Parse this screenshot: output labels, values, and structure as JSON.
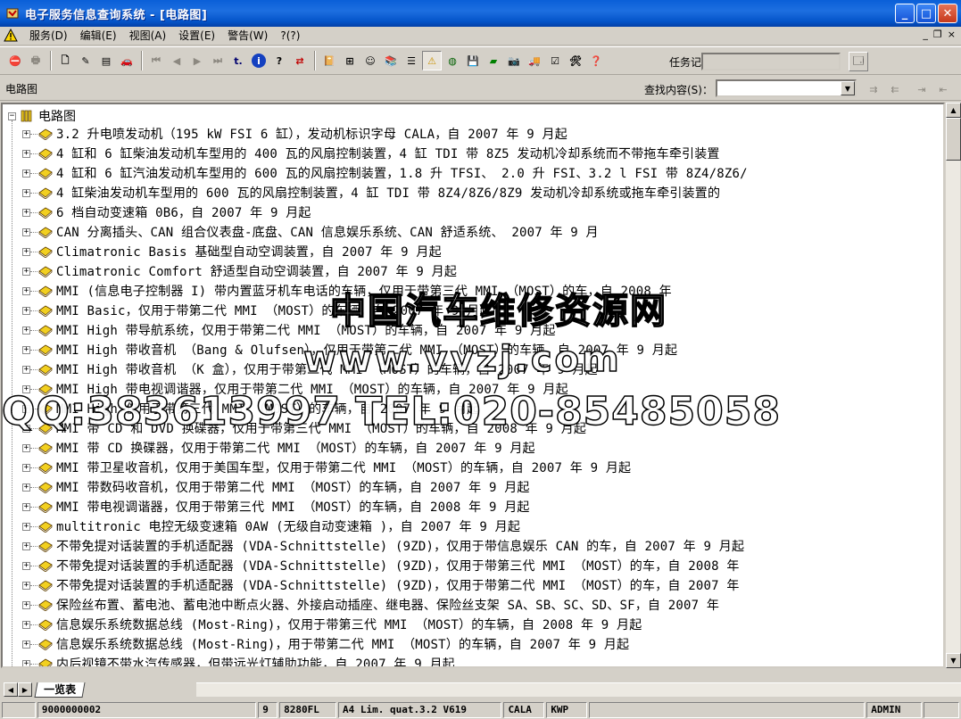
{
  "window": {
    "title": "电子服务信息查询系统 - [电路图]",
    "minimize_label": "_",
    "maximize_label": "□",
    "close_label": "✕"
  },
  "menu": {
    "items": [
      "服务(D)",
      "编辑(E)",
      "视图(A)",
      "设置(E)",
      "警告(W)",
      "?(?)"
    ],
    "mdi_min": "_",
    "mdi_restore": "❐",
    "mdi_close": "×"
  },
  "toolbar": {
    "task_label": "任务记录：",
    "task_value": ""
  },
  "subbar": {
    "crumb": "电路图",
    "search_label": "查找内容(S)：",
    "search_value": ""
  },
  "tree": {
    "root_label": "电路图",
    "items": [
      "3.2 升电喷发动机（195 kW FSI 6 缸），发动机标识字母 CALA，自 2007 年 9 月起",
      "4 缸和 6 缸柴油发动机车型用的 400 瓦的风扇控制装置，4 缸 TDI 带 8Z5 发动机冷却系统而不带拖车牵引装置",
      "4 缸和 6 缸汽油发动机车型用的 600 瓦的风扇控制装置，1.8 升 TFSI、 2.0 升 FSI、3.2 l FSI 带 8Z4/8Z6/",
      "4 缸柴油发动机车型用的 600 瓦的风扇控制装置，4 缸 TDI 带 8Z4/8Z6/8Z9 发动机冷却系统或拖车牵引装置的",
      "6 档自动变速箱 0B6，自 2007 年 9 月起",
      "CAN 分离插头、CAN 组合仪表盘-底盘、CAN 信息娱乐系统、CAN 舒适系统、 2007 年 9 月",
      "Climatronic Basis 基础型自动空调装置，自 2007 年 9 月起",
      "Climatronic Comfort 舒适型自动空调装置，自 2007 年 9 月起",
      "MMI (信息电子控制器 I) 带内置蓝牙机车电话的车辆，仅用于带第三代 MMI （MOST）的车，自 2008 年",
      "MMI Basic，仅用于带第二代 MMI （MOST）的车辆，自 2007 年 9 月起",
      "MMI High 带导航系统，仅用于带第二代 MMI （MOST）的车辆，自 2007 年 9 月起",
      "MMI High 带收音机 （Bang & Olufsen），仅用于带第二代 MMI （MOST）的车辆，自 2007 年 9 月起",
      "MMI High 带收音机 （K 盒），仅用于带第二代 MMI （MOST）的车辆，自 2007 年 9 月起",
      "MMI High 带电视调谐器，仅用于带第二代 MMI （MOST）的车辆，自 2007 年 9 月起",
      "MMI High 仅用于带第三代 MMI （MOST）的车辆，自 2007 年 9 月起",
      "MMI 带 CD 和 DVD 换碟器，仅用于带第三代 MMI （MOST）的车辆，自 2008 年 9 月起",
      "MMI 带 CD 换碟器，仅用于带第二代 MMI （MOST）的车辆，自 2007 年 9 月起",
      "MMI 带卫星收音机，仅用于美国车型，仅用于带第二代 MMI （MOST）的车辆，自 2007 年 9 月起",
      "MMI 带数码收音机，仅用于带第二代 MMI （MOST）的车辆，自 2007 年 9 月起",
      "MMI 带电视调谐器，仅用于带第三代 MMI （MOST）的车辆，自 2008 年 9 月起",
      "multitronic 电控无级变速箱 0AW (无级自动变速箱 )，自 2007 年 9 月起",
      "不带免提对话装置的手机适配器 (VDA-Schnittstelle) (9ZD)，仅用于带信息娱乐 CAN 的车，自 2007 年 9 月起",
      "不带免提对话装置的手机适配器 (VDA-Schnittstelle) (9ZD)，仅用于带第三代 MMI （MOST）的车，自 2008 年",
      "不带免提对话装置的手机适配器 (VDA-Schnittstelle) (9ZD)，仅用于带第二代 MMI （MOST）的车，自 2007 年",
      "保险丝布置、蓄电池、蓄电池中断点火器、外接启动插座、继电器、保险丝支架 SA、SB、SC、SD、SF，自 2007 年",
      "信息娱乐系统数据总线 (Most-Ring)，仅用于带第三代 MMI （MOST）的车辆，自 2008 年 9 月起",
      "信息娱乐系统数据总线 (Most-Ring)，用于带第二代 MMI （MOST）的车辆，自 2007 年 9 月起",
      "内后视镜不带水汽传感器，但带远光灯辅助功能，自 2007 年 9 月起"
    ]
  },
  "tabs": {
    "active": "一览表"
  },
  "status": {
    "cells": [
      "9000000002",
      "9",
      "8280FL",
      "A4 Lim. quat.3.2 V619",
      "CALA",
      "KWP",
      "",
      "ADMIN",
      ""
    ]
  },
  "watermark": {
    "line1": "中国汽车维修资源网",
    "line2": "www.vvzj.com",
    "line3": "QQ:383613997 TEL:020-85485058"
  }
}
